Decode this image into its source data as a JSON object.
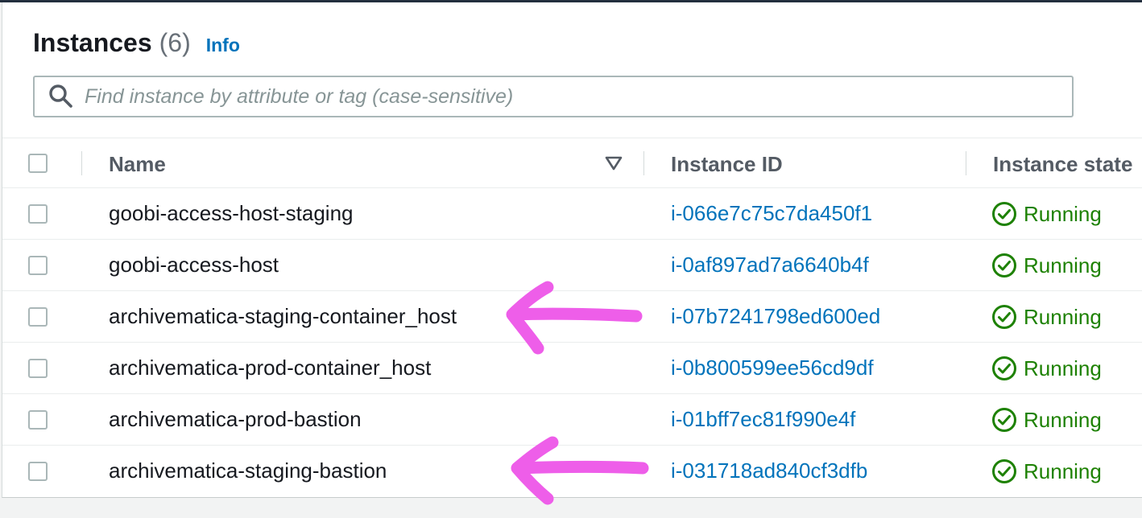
{
  "header": {
    "title": "Instances",
    "count": "(6)",
    "info_label": "Info"
  },
  "search": {
    "placeholder": "Find instance by attribute or tag (case-sensitive)",
    "value": ""
  },
  "table": {
    "columns": [
      "Name",
      "Instance ID",
      "Instance state"
    ],
    "rows": [
      {
        "name": "goobi-access-host-staging",
        "instance_id": "i-066e7c75c7da450f1",
        "state": "Running"
      },
      {
        "name": "goobi-access-host",
        "instance_id": "i-0af897ad7a6640b4f",
        "state": "Running"
      },
      {
        "name": "archivematica-staging-container_host",
        "instance_id": "i-07b7241798ed600ed",
        "state": "Running"
      },
      {
        "name": "archivematica-prod-container_host",
        "instance_id": "i-0b800599ee56cd9df",
        "state": "Running"
      },
      {
        "name": "archivematica-prod-bastion",
        "instance_id": "i-01bff7ec81f990e4f",
        "state": "Running"
      },
      {
        "name": "archivematica-staging-bastion",
        "instance_id": "i-031718ad840cf3dfb",
        "state": "Running"
      }
    ]
  },
  "colors": {
    "link": "#0073bb",
    "running": "#1d8102",
    "annotation": "#ee5ee9"
  },
  "annotations": {
    "highlighted_rows": [
      "archivematica-staging-container_host",
      "archivematica-staging-bastion"
    ]
  }
}
